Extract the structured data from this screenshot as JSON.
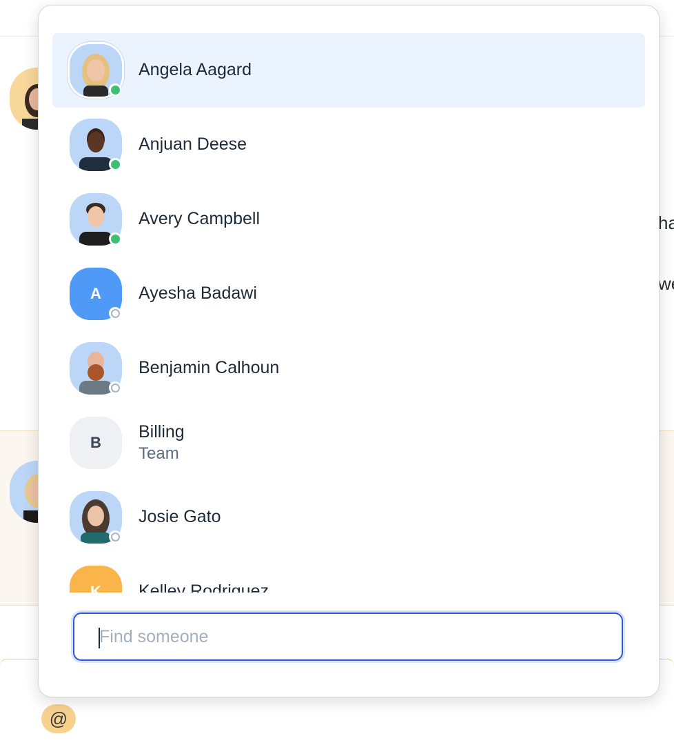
{
  "background": {
    "partial_texts": [
      "ha",
      "we"
    ],
    "composer": {
      "at_label": "@"
    }
  },
  "mention_picker": {
    "people": [
      {
        "name": "Angela Aagard",
        "status": "online",
        "selected": true,
        "avatar": "photo"
      },
      {
        "name": "Anjuan Deese",
        "status": "online",
        "selected": false,
        "avatar": "photo"
      },
      {
        "name": "Avery Campbell",
        "status": "online",
        "selected": false,
        "avatar": "photo"
      },
      {
        "name": "Ayesha Badawi",
        "status": "offline",
        "selected": false,
        "avatar": "initial",
        "initial": "A",
        "avatar_color": "#4f9af7"
      },
      {
        "name": "Benjamin Calhoun",
        "status": "offline",
        "selected": false,
        "avatar": "photo"
      },
      {
        "name": "Billing",
        "subtitle": "Team",
        "selected": false,
        "avatar": "initial",
        "initial": "B",
        "avatar_color": "#eef0f3"
      },
      {
        "name": "Josie Gato",
        "status": "offline",
        "selected": false,
        "avatar": "photo"
      },
      {
        "name": "Kelley Rodriguez",
        "selected": false,
        "avatar": "initial",
        "initial": "K",
        "avatar_color": "#f9b44a"
      }
    ],
    "search": {
      "placeholder": "Find someone",
      "value": ""
    }
  },
  "colors": {
    "selected_row": "#ebf3fe",
    "online": "#3fbf74",
    "offline": "#a9b3c1",
    "focus": "#2c55d8",
    "avatar_photo_bg": "#bcd6f8"
  }
}
